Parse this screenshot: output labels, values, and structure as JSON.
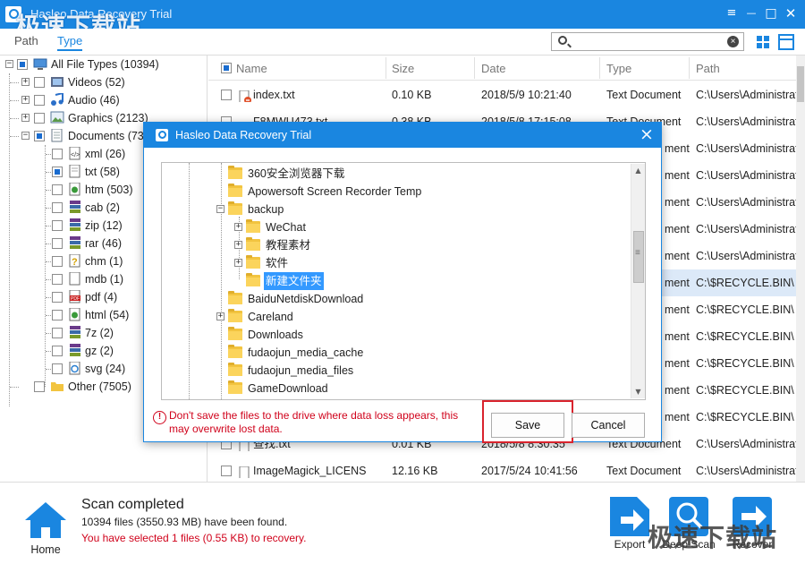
{
  "app": {
    "title": "Hasleo Data Recovery Trial",
    "watermark": "极速下载站"
  },
  "window_controls": {
    "menu": "≡",
    "minimize": "—",
    "maximize": "□",
    "close": "✕"
  },
  "tabs": [
    {
      "label": "Path"
    },
    {
      "label": "Type"
    }
  ],
  "search": {
    "value": "",
    "placeholder": ""
  },
  "tree": {
    "root": {
      "label": "All File Types (10394)"
    },
    "videos": {
      "label": "Videos (52)"
    },
    "audio": {
      "label": "Audio (46)"
    },
    "graphics": {
      "label": "Graphics (2123)"
    },
    "documents": {
      "label": "Documents (73"
    },
    "docs": [
      {
        "label": "xml (26)",
        "icon": "xml-file-icon"
      },
      {
        "label": "txt (58)",
        "icon": "txt-file-icon"
      },
      {
        "label": "htm (503)",
        "icon": "htm-file-icon"
      },
      {
        "label": "cab (2)",
        "icon": "archive-file-icon"
      },
      {
        "label": "zip (12)",
        "icon": "archive-file-icon"
      },
      {
        "label": "rar (46)",
        "icon": "archive-file-icon"
      },
      {
        "label": "chm (1)",
        "icon": "chm-file-icon"
      },
      {
        "label": "mdb (1)",
        "icon": "mdb-file-icon"
      },
      {
        "label": "pdf (4)",
        "icon": "pdf-file-icon"
      },
      {
        "label": "html (54)",
        "icon": "html-file-icon"
      },
      {
        "label": "7z (2)",
        "icon": "archive-file-icon"
      },
      {
        "label": "gz (2)",
        "icon": "archive-file-icon"
      },
      {
        "label": "svg (24)",
        "icon": "svg-file-icon"
      }
    ],
    "other": {
      "label": "Other (7505)"
    }
  },
  "list": {
    "columns": {
      "name": "Name",
      "size": "Size",
      "date": "Date",
      "type": "Type",
      "path": "Path"
    },
    "rows": [
      {
        "name": "index.txt",
        "size": "0.10 KB",
        "date": "2018/5/9 10:21:40",
        "type": "Text Document",
        "path": "C:\\Users\\Administrat"
      },
      {
        "name": "F8MWU473.txt",
        "size": "0.38 KB",
        "date": "2018/5/8 17:15:08",
        "type": "Text Document",
        "path": "C:\\Users\\Administrat"
      },
      {
        "name": "",
        "size": "",
        "date": "",
        "type": "ment",
        "path": "C:\\Users\\Administrat"
      },
      {
        "name": "",
        "size": "",
        "date": "",
        "type": "ment",
        "path": "C:\\Users\\Administrat"
      },
      {
        "name": "",
        "size": "",
        "date": "",
        "type": "ment",
        "path": "C:\\Users\\Administrat"
      },
      {
        "name": "",
        "size": "",
        "date": "",
        "type": "ment",
        "path": "C:\\Users\\Administrat"
      },
      {
        "name": "",
        "size": "",
        "date": "",
        "type": "ment",
        "path": "C:\\Users\\Administrat"
      },
      {
        "name": "",
        "size": "",
        "date": "",
        "type": "ment",
        "path": "C:\\$RECYCLE.BIN\\"
      },
      {
        "name": "",
        "size": "",
        "date": "",
        "type": "ment",
        "path": "C:\\$RECYCLE.BIN\\"
      },
      {
        "name": "",
        "size": "",
        "date": "",
        "type": "ment",
        "path": "C:\\$RECYCLE.BIN\\"
      },
      {
        "name": "",
        "size": "",
        "date": "",
        "type": "ment",
        "path": "C:\\$RECYCLE.BIN\\"
      },
      {
        "name": "",
        "size": "",
        "date": "",
        "type": "ment",
        "path": "C:\\$RECYCLE.BIN\\"
      },
      {
        "name": "",
        "size": "",
        "date": "",
        "type": "ment",
        "path": "C:\\$RECYCLE.BIN\\"
      },
      {
        "name": "查找.txt",
        "size": "0.01 KB",
        "date": "2018/5/8 8:30:35",
        "type": "Text Document",
        "path": "C:\\Users\\Administrat"
      },
      {
        "name": "ImageMagick_LICENS",
        "size": "12.16 KB",
        "date": "2017/5/24 10:41:56",
        "type": "Text Document",
        "path": "C:\\Users\\Administrat"
      }
    ]
  },
  "bottom": {
    "home_label": "Home",
    "scan_title": "Scan completed",
    "scan_files": "10394 files (3550.93 MB) have been found.",
    "scan_selected": "You have selected 1 files (0.55 KB) to recovery.",
    "export_label": "Export",
    "deep_scan_label": "Deep Scan",
    "recover_label": "Recover",
    "watermark": "极速下载站"
  },
  "dialog": {
    "title": "Hasleo Data Recovery Trial",
    "folders": [
      {
        "label": "360安全浏览器下载",
        "level": 0,
        "expander": ""
      },
      {
        "label": "Apowersoft Screen Recorder Temp",
        "level": 0,
        "expander": ""
      },
      {
        "label": "backup",
        "level": 0,
        "expander": "−"
      },
      {
        "label": "WeChat",
        "level": 1,
        "expander": "+"
      },
      {
        "label": "教程素材",
        "level": 1,
        "expander": "+"
      },
      {
        "label": "软件",
        "level": 1,
        "expander": "+"
      },
      {
        "label": "新建文件夹",
        "level": 1,
        "expander": "",
        "selected": true
      },
      {
        "label": "BaiduNetdiskDownload",
        "level": 0,
        "expander": ""
      },
      {
        "label": "Careland",
        "level": 0,
        "expander": "+"
      },
      {
        "label": "Downloads",
        "level": 0,
        "expander": ""
      },
      {
        "label": "fudaojun_media_cache",
        "level": 0,
        "expander": ""
      },
      {
        "label": "fudaojun_media_files",
        "level": 0,
        "expander": ""
      },
      {
        "label": "GameDownload",
        "level": 0,
        "expander": ""
      }
    ],
    "warning": "Don't save the files to the drive where data loss appears, this may overwrite lost data.",
    "save_label": "Save",
    "cancel_label": "Cancel"
  },
  "colors": {
    "accent": "#1a86e0",
    "warning": "#d0021b",
    "selection": "#3399ff",
    "highlight_box": "#d9232d"
  }
}
